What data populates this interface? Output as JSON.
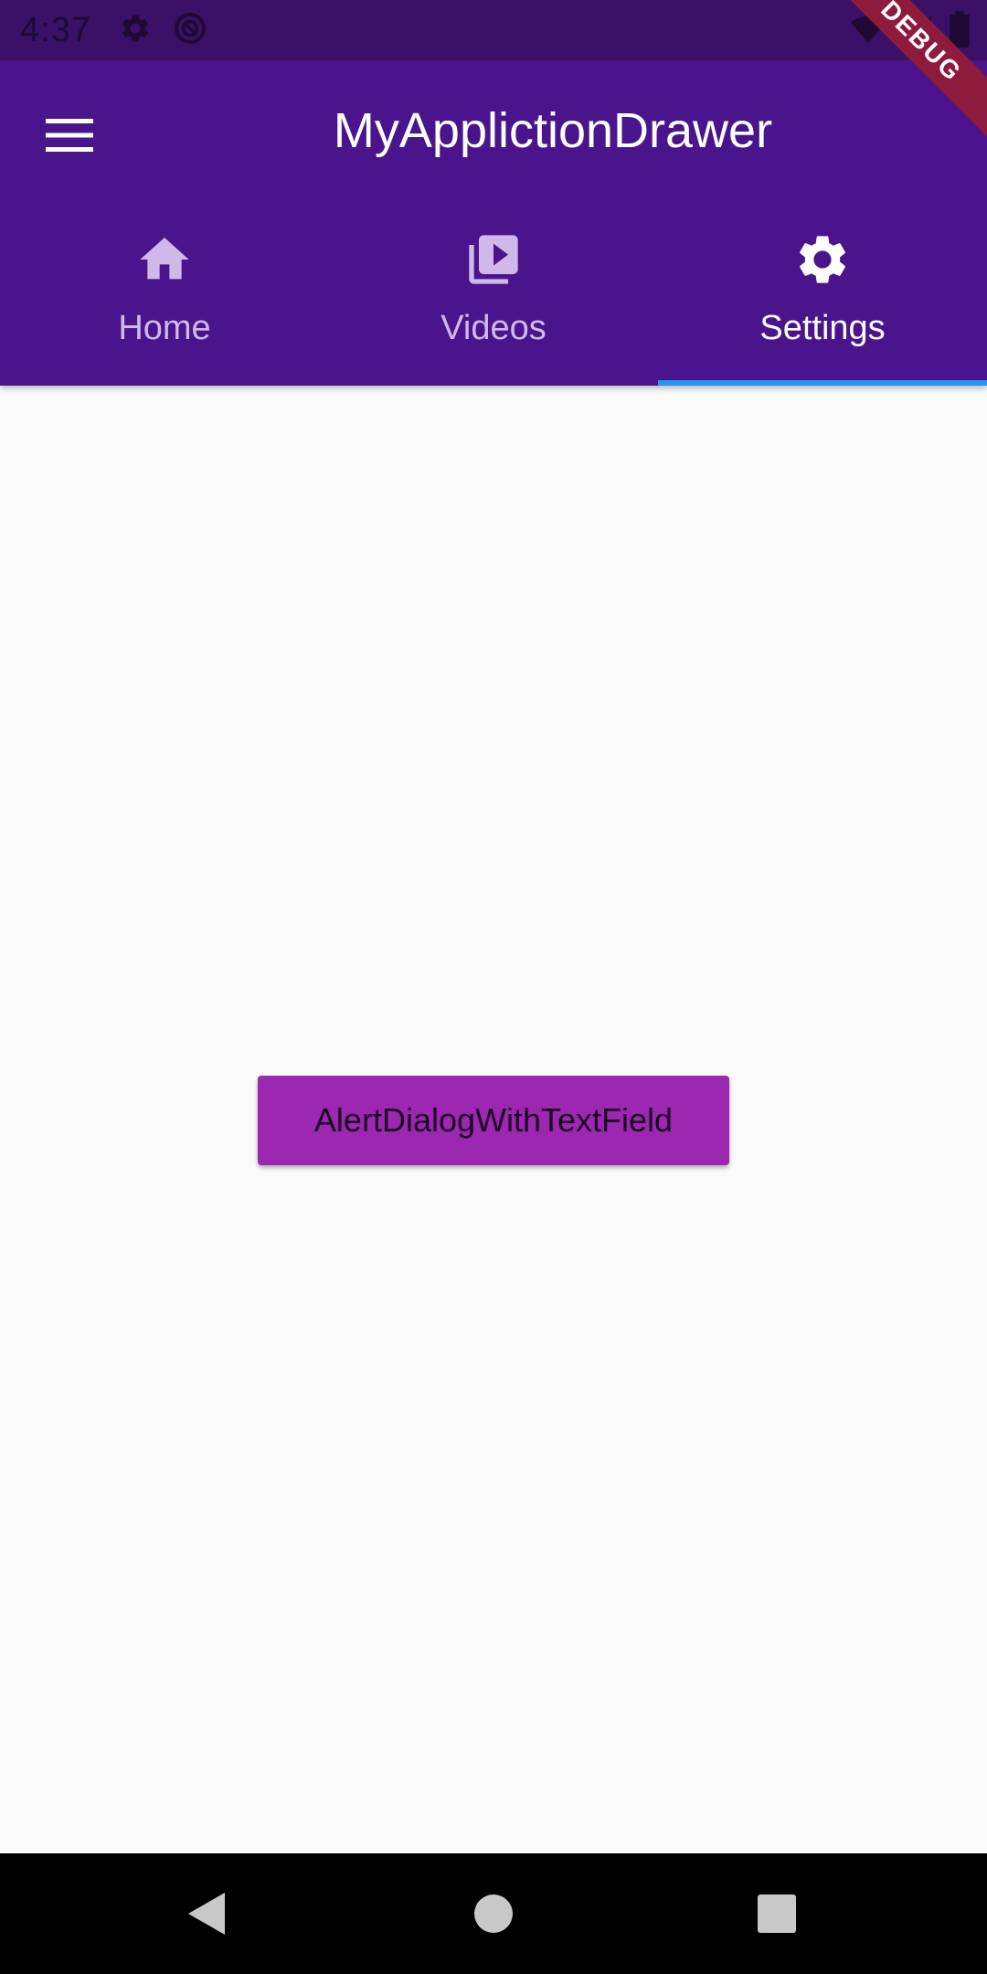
{
  "status_bar": {
    "time": "4:37",
    "icons": [
      "gear-icon",
      "sync-circle-icon",
      "wifi-icon",
      "signal-icon",
      "battery-icon"
    ]
  },
  "debug_banner": "DEBUG",
  "app_bar": {
    "title": "MyApplictionDrawer",
    "menu_icon": "hamburger-menu-icon",
    "background_color": "#4a148c"
  },
  "tabs": [
    {
      "label": "Home",
      "icon": "home-icon",
      "selected": false
    },
    {
      "label": "Videos",
      "icon": "video-library-icon",
      "selected": false
    },
    {
      "label": "Settings",
      "icon": "settings-gear-icon",
      "selected": true
    }
  ],
  "tab_indicator_color": "#2196f3",
  "main": {
    "button_label": "AlertDialogWithTextField",
    "button_color": "#9c27b0"
  },
  "nav_bar": {
    "buttons": [
      "back-icon",
      "home-circle-icon",
      "recents-square-icon"
    ]
  }
}
